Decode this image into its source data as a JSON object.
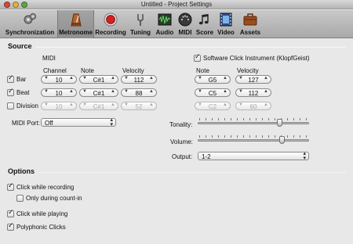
{
  "window": {
    "title": "Untitled - Project Settings"
  },
  "toolbar": {
    "items": [
      {
        "label": "Synchronization",
        "icon": "synchronization-gears-icon",
        "selected": false
      },
      {
        "label": "Metronome",
        "icon": "metronome-icon",
        "selected": true
      },
      {
        "label": "Recording",
        "icon": "record-icon",
        "selected": false
      },
      {
        "label": "Tuning",
        "icon": "tuning-fork-icon",
        "selected": false
      },
      {
        "label": "Audio",
        "icon": "audio-waveform-icon",
        "selected": false
      },
      {
        "label": "MIDI",
        "icon": "midi-connector-icon",
        "selected": false
      },
      {
        "label": "Score",
        "icon": "score-notes-icon",
        "selected": false
      },
      {
        "label": "Video",
        "icon": "video-film-icon",
        "selected": false
      },
      {
        "label": "Assets",
        "icon": "assets-briefcase-icon",
        "selected": false
      }
    ]
  },
  "source": {
    "title": "Source",
    "midi_header": "MIDI",
    "software_click": {
      "label": "Software Click Instrument (KlopfGeist)",
      "checked": true
    },
    "columns": {
      "channel": "Channel",
      "note": "Note",
      "velocity": "Velocity"
    },
    "rows": [
      {
        "label": "Bar",
        "checked": true,
        "enabled": true,
        "channel": "10",
        "note": "C#1",
        "velocity": "112",
        "sw_note": "G5",
        "sw_velocity": "127"
      },
      {
        "label": "Beat",
        "checked": true,
        "enabled": true,
        "channel": "10",
        "note": "C#1",
        "velocity": "88",
        "sw_note": "C5",
        "sw_velocity": "112"
      },
      {
        "label": "Division",
        "checked": false,
        "enabled": false,
        "channel": "10",
        "note": "C#1",
        "velocity": "52",
        "sw_note": "C2",
        "sw_velocity": "60"
      }
    ],
    "midi_port": {
      "label": "MIDI Port:",
      "value": "Off"
    },
    "tonality": {
      "label": "Tonality:",
      "level": 0.73
    },
    "volume": {
      "label": "Volume:",
      "level": 0.75
    },
    "output": {
      "label": "Output:",
      "value": "1-2"
    }
  },
  "options": {
    "title": "Options",
    "items": [
      {
        "label": "Click while recording",
        "checked": true
      },
      {
        "label": "Only during count-in",
        "checked": false
      },
      {
        "label": "Click while playing",
        "checked": true
      },
      {
        "label": "Polyphonic Clicks",
        "checked": true
      }
    ]
  }
}
